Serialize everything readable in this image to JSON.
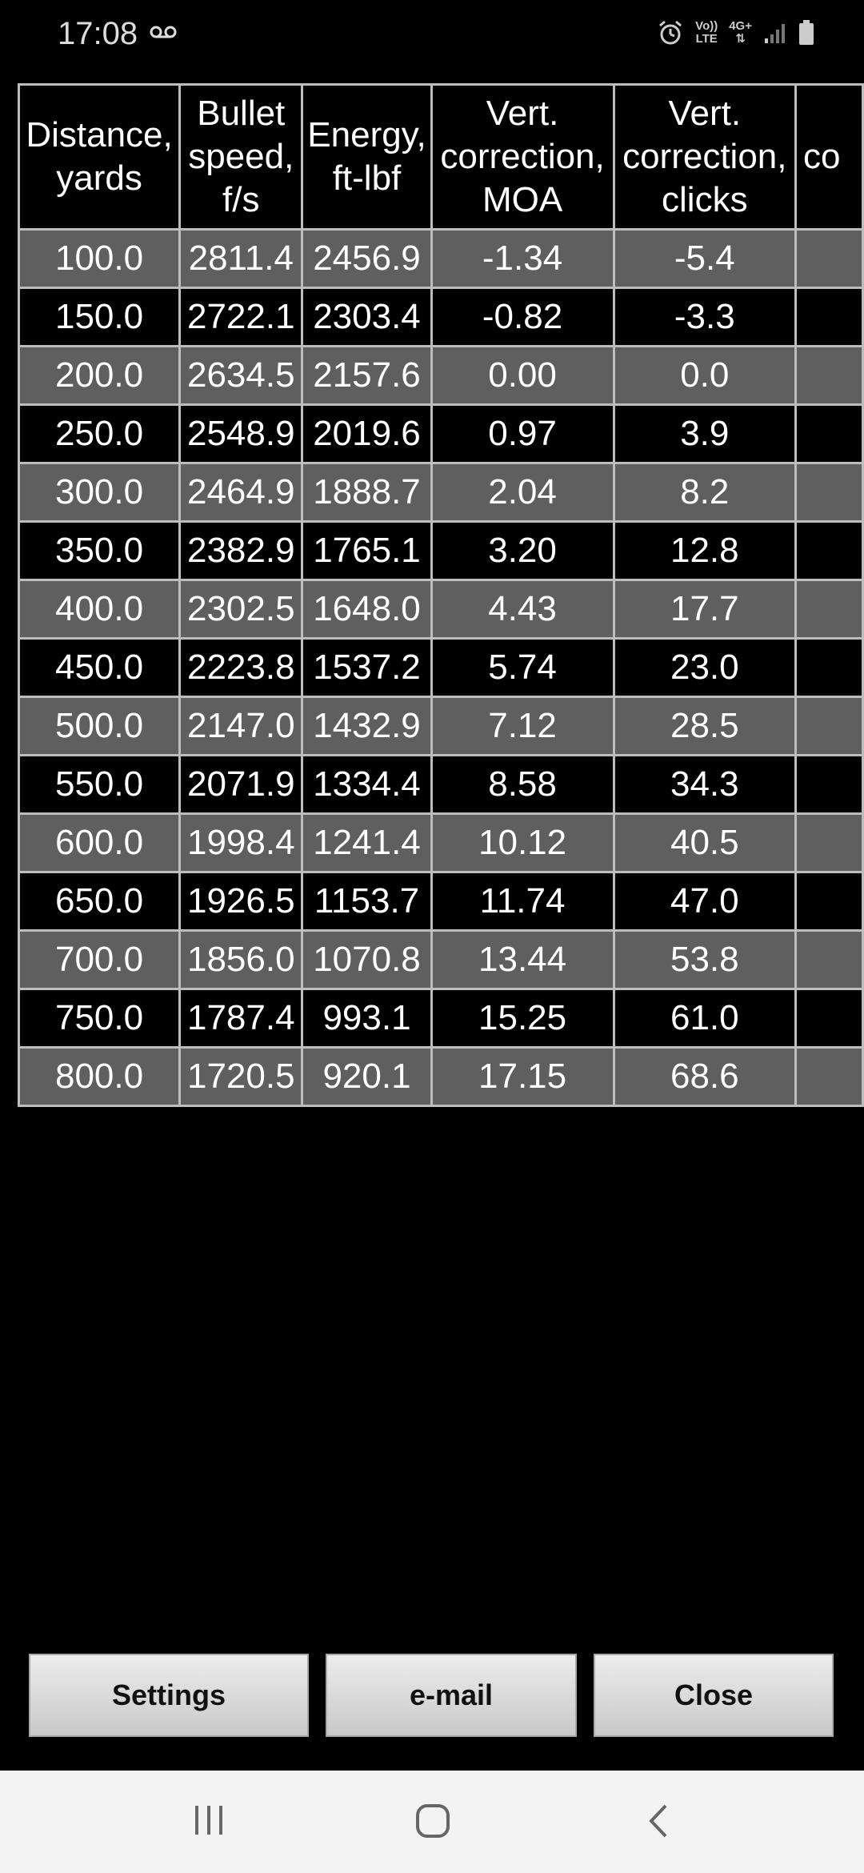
{
  "status_bar": {
    "time": "17:08",
    "network_top": "Vo))",
    "network_bottom": "LTE",
    "data_type": "4G+"
  },
  "table": {
    "headers": [
      "Distance, yards",
      "Bullet speed, f/s",
      "Energy, ft-lbf",
      "Vert. correction, MOA",
      "Vert. correction, clicks",
      "co"
    ],
    "rows": [
      [
        "100.0",
        "2811.4",
        "2456.9",
        "-1.34",
        "-5.4",
        ""
      ],
      [
        "150.0",
        "2722.1",
        "2303.4",
        "-0.82",
        "-3.3",
        ""
      ],
      [
        "200.0",
        "2634.5",
        "2157.6",
        "0.00",
        "0.0",
        ""
      ],
      [
        "250.0",
        "2548.9",
        "2019.6",
        "0.97",
        "3.9",
        ""
      ],
      [
        "300.0",
        "2464.9",
        "1888.7",
        "2.04",
        "8.2",
        ""
      ],
      [
        "350.0",
        "2382.9",
        "1765.1",
        "3.20",
        "12.8",
        ""
      ],
      [
        "400.0",
        "2302.5",
        "1648.0",
        "4.43",
        "17.7",
        ""
      ],
      [
        "450.0",
        "2223.8",
        "1537.2",
        "5.74",
        "23.0",
        ""
      ],
      [
        "500.0",
        "2147.0",
        "1432.9",
        "7.12",
        "28.5",
        ""
      ],
      [
        "550.0",
        "2071.9",
        "1334.4",
        "8.58",
        "34.3",
        ""
      ],
      [
        "600.0",
        "1998.4",
        "1241.4",
        "10.12",
        "40.5",
        ""
      ],
      [
        "650.0",
        "1926.5",
        "1153.7",
        "11.74",
        "47.0",
        ""
      ],
      [
        "700.0",
        "1856.0",
        "1070.8",
        "13.44",
        "53.8",
        ""
      ],
      [
        "750.0",
        "1787.4",
        "993.1",
        "15.25",
        "61.0",
        ""
      ],
      [
        "800.0",
        "1720.5",
        "920.1",
        "17.15",
        "68.6",
        ""
      ]
    ]
  },
  "buttons": {
    "settings": "Settings",
    "email": "e-mail",
    "close": "Close"
  },
  "navbar": {
    "icons": [
      "recent-apps-icon",
      "home-icon",
      "back-icon"
    ]
  },
  "colors": {
    "row_odd": "#5f5f5f",
    "row_even": "#000000",
    "grid": "#bdbdbd",
    "background": "#000000"
  }
}
